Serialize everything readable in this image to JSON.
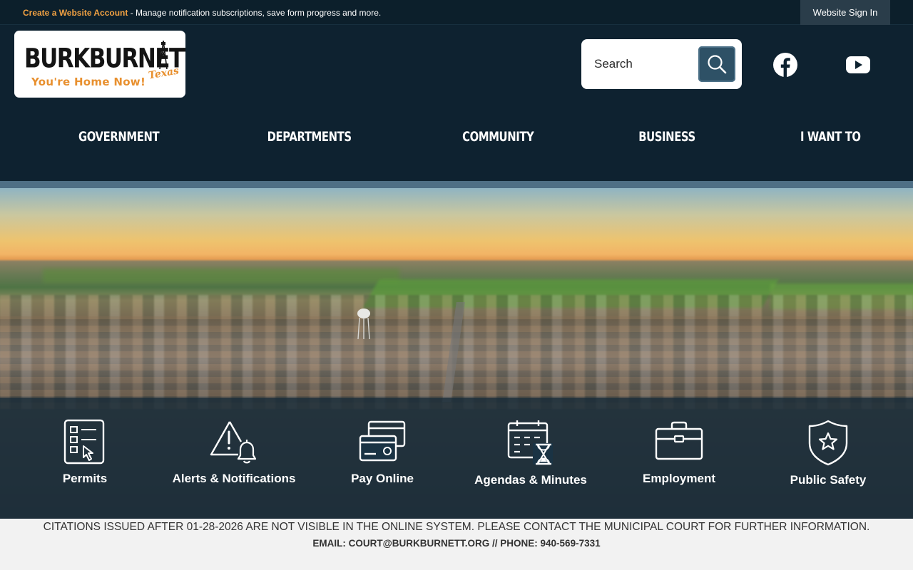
{
  "topbar": {
    "create_account_link": "Create a Website Account",
    "create_account_text": " - Manage notification subscriptions, save form progress and more.",
    "sign_in": "Website Sign In"
  },
  "logo": {
    "wordmark": "BURKBURNETT",
    "state": "Texas",
    "tagline": "You're Home Now!"
  },
  "search": {
    "placeholder": "Search",
    "icon": "search-icon"
  },
  "social": [
    {
      "name": "facebook-icon"
    },
    {
      "name": "youtube-icon"
    }
  ],
  "nav": {
    "items": [
      "GOVERNMENT",
      "DEPARTMENTS",
      "COMMUNITY",
      "BUSINESS",
      "I WANT TO"
    ]
  },
  "quick_links": [
    {
      "label": "Permits",
      "icon": "permits-checklist-icon"
    },
    {
      "label": "Alerts & Notifications",
      "icon": "alert-bell-icon"
    },
    {
      "label": "Pay Online",
      "icon": "credit-card-icon"
    },
    {
      "label": "Agendas & Minutes",
      "icon": "calendar-hourglass-icon"
    },
    {
      "label": "Employment",
      "icon": "briefcase-icon"
    },
    {
      "label": "Public Safety",
      "icon": "shield-star-icon"
    }
  ],
  "alert": {
    "line1": "CITATIONS ISSUED AFTER 01-28-2026 ARE NOT VISIBLE IN THE ONLINE SYSTEM. PLEASE CONTACT THE MUNICIPAL COURT FOR FURTHER INFORMATION.",
    "line2": "EMAIL: COURT@BURKBURNETT.ORG // PHONE: 940-569-7331"
  },
  "colors": {
    "header_bg": "#0e2230",
    "accent_orange": "#f0a042",
    "search_button": "#2e5166"
  }
}
